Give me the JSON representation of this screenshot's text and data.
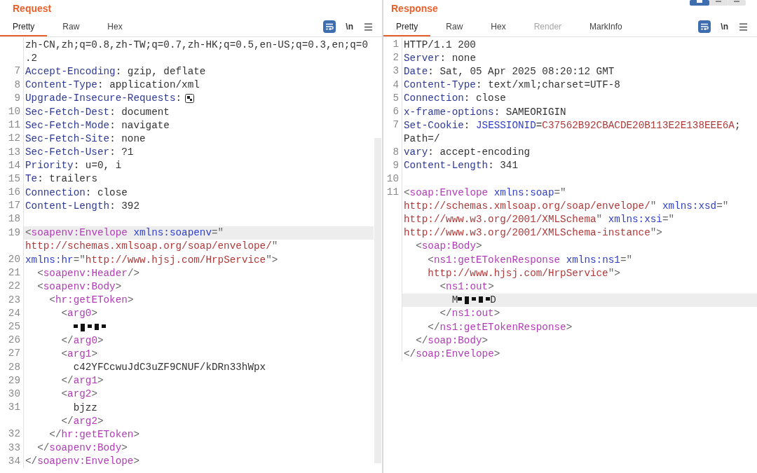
{
  "request": {
    "title": "Request",
    "tabs": [
      {
        "label": "Pretty",
        "selected": true,
        "disabled": false
      },
      {
        "label": "Raw",
        "selected": false,
        "disabled": false
      },
      {
        "label": "Hex",
        "selected": false,
        "disabled": false
      }
    ],
    "toolbar": {
      "newline_label": "\\n"
    },
    "lines": [
      {
        "highlighted": false,
        "tokens": [
          {
            "kind": "plain",
            "text": "zh-CN,zh;q=0.8,zh-TW;q=0.7,zh-HK;q=0.5,en-US;q=0.3,en;q=0"
          }
        ]
      },
      {
        "highlighted": false,
        "tokens": [
          {
            "kind": "plain",
            "text": ".2"
          }
        ]
      },
      {
        "number": "7",
        "highlighted": false,
        "tokens": [
          {
            "kind": "key",
            "text": "Accept-Encoding"
          },
          {
            "kind": "plain",
            "text": ": gzip, deflate"
          }
        ]
      },
      {
        "number": "8",
        "highlighted": false,
        "tokens": [
          {
            "kind": "key",
            "text": "Content-Type"
          },
          {
            "kind": "plain",
            "text": ": application/xml"
          }
        ]
      },
      {
        "number": "9",
        "highlighted": false,
        "tokens": [
          {
            "kind": "key",
            "text": "Upgrade-Insecure-Requests"
          },
          {
            "kind": "plain",
            "text": ":"
          },
          {
            "kind": "marker"
          }
        ]
      },
      {
        "number": "10",
        "highlighted": false,
        "tokens": [
          {
            "kind": "key",
            "text": "Sec-Fetch-Dest"
          },
          {
            "kind": "plain",
            "text": ": document"
          }
        ]
      },
      {
        "number": "11",
        "highlighted": false,
        "tokens": [
          {
            "kind": "key",
            "text": "Sec-Fetch-Mode"
          },
          {
            "kind": "plain",
            "text": ": navigate"
          }
        ]
      },
      {
        "number": "12",
        "highlighted": false,
        "tokens": [
          {
            "kind": "key",
            "text": "Sec-Fetch-Site"
          },
          {
            "kind": "plain",
            "text": ": none"
          }
        ]
      },
      {
        "number": "13",
        "highlighted": false,
        "tokens": [
          {
            "kind": "key",
            "text": "Sec-Fetch-User"
          },
          {
            "kind": "plain",
            "text": ": ?1"
          }
        ]
      },
      {
        "number": "14",
        "highlighted": false,
        "tokens": [
          {
            "kind": "key",
            "text": "Priority"
          },
          {
            "kind": "plain",
            "text": ": u=0, i"
          }
        ]
      },
      {
        "number": "15",
        "highlighted": false,
        "tokens": [
          {
            "kind": "key",
            "text": "Te"
          },
          {
            "kind": "plain",
            "text": ": trailers"
          }
        ]
      },
      {
        "number": "16",
        "highlighted": false,
        "tokens": [
          {
            "kind": "key",
            "text": "Connection"
          },
          {
            "kind": "plain",
            "text": ": close"
          }
        ]
      },
      {
        "number": "17",
        "highlighted": false,
        "tokens": [
          {
            "kind": "key",
            "text": "Content-Length"
          },
          {
            "kind": "plain",
            "text": ": 392"
          }
        ]
      },
      {
        "number": "18",
        "highlighted": false
      },
      {
        "number": "19",
        "highlighted": true,
        "tokens": [
          {
            "kind": "punct",
            "text": "<"
          },
          {
            "kind": "tag",
            "text": "soapenv:Envelope"
          },
          {
            "kind": "attr",
            "text": " xmlns:soapenv"
          },
          {
            "kind": "punct",
            "text": "=\""
          }
        ]
      },
      {
        "highlighted": false,
        "tokens": [
          {
            "kind": "value",
            "text": "http://schemas.xmlsoap.org/soap/envelope/"
          },
          {
            "kind": "punct",
            "text": "\""
          }
        ]
      },
      {
        "number": "20",
        "highlighted": false,
        "tokens": [
          {
            "kind": "attr",
            "text": "xmlns:hr"
          },
          {
            "kind": "punct",
            "text": "=\""
          },
          {
            "kind": "value",
            "text": "http://www.hjsj.com/HrpService"
          },
          {
            "kind": "punct",
            "text": "\">"
          }
        ]
      },
      {
        "number": "21",
        "highlighted": false,
        "tokens": [
          {
            "kind": "punct",
            "text": "  <"
          },
          {
            "kind": "tag",
            "text": "soapenv:Header"
          },
          {
            "kind": "punct",
            "text": "/>"
          }
        ]
      },
      {
        "number": "22",
        "highlighted": false,
        "tokens": [
          {
            "kind": "punct",
            "text": "  <"
          },
          {
            "kind": "tag",
            "text": "soapenv:Body"
          },
          {
            "kind": "punct",
            "text": ">"
          }
        ]
      },
      {
        "number": "23",
        "highlighted": false,
        "tokens": [
          {
            "kind": "punct",
            "text": "    <"
          },
          {
            "kind": "tag",
            "text": "hr:getEToken"
          },
          {
            "kind": "punct",
            "text": ">"
          }
        ]
      },
      {
        "number": "24",
        "highlighted": false,
        "tokens": [
          {
            "kind": "punct",
            "text": "      <"
          },
          {
            "kind": "tag",
            "text": "arg0"
          },
          {
            "kind": "punct",
            "text": ">"
          }
        ]
      },
      {
        "number": "25",
        "highlighted": false,
        "tokens": [
          {
            "kind": "redacted"
          }
        ]
      },
      {
        "number": "26",
        "highlighted": false,
        "tokens": [
          {
            "kind": "punct",
            "text": "      </"
          },
          {
            "kind": "tag",
            "text": "arg0"
          },
          {
            "kind": "punct",
            "text": ">"
          }
        ]
      },
      {
        "number": "27",
        "highlighted": false,
        "tokens": [
          {
            "kind": "punct",
            "text": "      <"
          },
          {
            "kind": "tag",
            "text": "arg1"
          },
          {
            "kind": "punct",
            "text": ">"
          }
        ]
      },
      {
        "number": "28",
        "highlighted": false,
        "tokens": [
          {
            "kind": "plain",
            "text": "        c42YFCcwuJdC3uZF9CNUF/kDRn33hWpx"
          }
        ]
      },
      {
        "number": "29",
        "highlighted": false,
        "tokens": [
          {
            "kind": "punct",
            "text": "      </"
          },
          {
            "kind": "tag",
            "text": "arg1"
          },
          {
            "kind": "punct",
            "text": ">"
          }
        ]
      },
      {
        "number": "30",
        "highlighted": false,
        "tokens": [
          {
            "kind": "punct",
            "text": "      <"
          },
          {
            "kind": "tag",
            "text": "arg2"
          },
          {
            "kind": "punct",
            "text": ">"
          }
        ]
      },
      {
        "number": "31",
        "highlighted": false,
        "tokens": [
          {
            "kind": "plain",
            "text": "        bjzz"
          }
        ]
      },
      {
        "highlighted": false,
        "tokens": [
          {
            "kind": "punct",
            "text": "      </"
          },
          {
            "kind": "tag",
            "text": "arg2"
          },
          {
            "kind": "punct",
            "text": ">"
          }
        ]
      },
      {
        "number": "32",
        "highlighted": false,
        "tokens": [
          {
            "kind": "punct",
            "text": "    </"
          },
          {
            "kind": "tag",
            "text": "hr:getEToken"
          },
          {
            "kind": "punct",
            "text": ">"
          }
        ]
      },
      {
        "number": "33",
        "highlighted": false,
        "tokens": [
          {
            "kind": "punct",
            "text": "  </"
          },
          {
            "kind": "tag",
            "text": "soapenv:Body"
          },
          {
            "kind": "punct",
            "text": ">"
          }
        ]
      },
      {
        "number": "34",
        "highlighted": false,
        "tokens": [
          {
            "kind": "punct",
            "text": "</"
          },
          {
            "kind": "tag",
            "text": "soapenv:Envelope"
          },
          {
            "kind": "punct",
            "text": ">"
          }
        ]
      }
    ]
  },
  "response": {
    "title": "Response",
    "tabs": [
      {
        "label": "Pretty",
        "selected": true,
        "disabled": false
      },
      {
        "label": "Raw",
        "selected": false,
        "disabled": false
      },
      {
        "label": "Hex",
        "selected": false,
        "disabled": false
      },
      {
        "label": "Render",
        "selected": false,
        "disabled": true
      },
      {
        "label": "MarkInfo",
        "selected": false,
        "disabled": false
      }
    ],
    "toolbar": {
      "newline_label": "\\n"
    },
    "lines": [
      {
        "number": "1",
        "highlighted": false,
        "tokens": [
          {
            "kind": "plain",
            "text": "HTTP/1.1 200"
          }
        ]
      },
      {
        "number": "2",
        "highlighted": false,
        "tokens": [
          {
            "kind": "key",
            "text": "Server"
          },
          {
            "kind": "plain",
            "text": ": none"
          }
        ]
      },
      {
        "number": "3",
        "highlighted": false,
        "tokens": [
          {
            "kind": "key",
            "text": "Date"
          },
          {
            "kind": "plain",
            "text": ": Sat, 05 Apr 2025 08:20:12 GMT"
          }
        ]
      },
      {
        "number": "4",
        "highlighted": false,
        "tokens": [
          {
            "kind": "key",
            "text": "Content-Type"
          },
          {
            "kind": "plain",
            "text": ": text/xml;charset=UTF-8"
          }
        ]
      },
      {
        "number": "5",
        "highlighted": false,
        "tokens": [
          {
            "kind": "key",
            "text": "Connection"
          },
          {
            "kind": "plain",
            "text": ": close"
          }
        ]
      },
      {
        "number": "6",
        "highlighted": false,
        "tokens": [
          {
            "kind": "key",
            "text": "x-frame-options"
          },
          {
            "kind": "plain",
            "text": ": SAMEORIGIN"
          }
        ]
      },
      {
        "number": "7",
        "highlighted": false,
        "tokens": [
          {
            "kind": "key",
            "text": "Set-Cookie"
          },
          {
            "kind": "plain",
            "text": ": "
          },
          {
            "kind": "attr",
            "text": "JSESSIONID"
          },
          {
            "kind": "plain",
            "text": "="
          },
          {
            "kind": "value",
            "text": "C37562B92CBACDE20B113E2E138EEE6A"
          },
          {
            "kind": "plain",
            "text": ";"
          }
        ]
      },
      {
        "highlighted": false,
        "tokens": [
          {
            "kind": "plain",
            "text": "Path=/"
          }
        ]
      },
      {
        "number": "8",
        "highlighted": false,
        "tokens": [
          {
            "kind": "key",
            "text": "vary"
          },
          {
            "kind": "plain",
            "text": ": accept-encoding"
          }
        ]
      },
      {
        "number": "9",
        "highlighted": false,
        "tokens": [
          {
            "kind": "key",
            "text": "Content-Length"
          },
          {
            "kind": "plain",
            "text": ": 341"
          }
        ]
      },
      {
        "number": "10",
        "highlighted": false
      },
      {
        "number": "11",
        "highlighted": false,
        "tokens": [
          {
            "kind": "punct",
            "text": "<"
          },
          {
            "kind": "tag",
            "text": "soap:Envelope"
          },
          {
            "kind": "attr",
            "text": " xmlns:soap"
          },
          {
            "kind": "punct",
            "text": "=\""
          }
        ]
      },
      {
        "highlighted": false,
        "tokens": [
          {
            "kind": "value",
            "text": "http://schemas.xmlsoap.org/soap/envelope/"
          },
          {
            "kind": "punct",
            "text": "\" "
          },
          {
            "kind": "attr",
            "text": "xmlns:xsd"
          },
          {
            "kind": "punct",
            "text": "=\""
          }
        ]
      },
      {
        "highlighted": false,
        "tokens": [
          {
            "kind": "value",
            "text": "http://www.w3.org/2001/XMLSchema"
          },
          {
            "kind": "punct",
            "text": "\" "
          },
          {
            "kind": "attr",
            "text": "xmlns:xsi"
          },
          {
            "kind": "punct",
            "text": "=\""
          }
        ]
      },
      {
        "highlighted": false,
        "tokens": [
          {
            "kind": "value",
            "text": "http://www.w3.org/2001/XMLSchema-instance"
          },
          {
            "kind": "punct",
            "text": "\">"
          }
        ]
      },
      {
        "highlighted": false,
        "tokens": [
          {
            "kind": "punct",
            "text": "  <"
          },
          {
            "kind": "tag",
            "text": "soap:Body"
          },
          {
            "kind": "punct",
            "text": ">"
          }
        ]
      },
      {
        "highlighted": false,
        "tokens": [
          {
            "kind": "punct",
            "text": "    <"
          },
          {
            "kind": "tag",
            "text": "ns1:getETokenResponse"
          },
          {
            "kind": "attr",
            "text": " xmlns:ns1"
          },
          {
            "kind": "punct",
            "text": "=\""
          }
        ]
      },
      {
        "highlighted": false,
        "tokens": [
          {
            "kind": "value",
            "text": "    http://www.hjsj.com/HrpService"
          },
          {
            "kind": "punct",
            "text": "\">"
          }
        ]
      },
      {
        "highlighted": false,
        "tokens": [
          {
            "kind": "punct",
            "text": "      <"
          },
          {
            "kind": "tag",
            "text": "ns1:out"
          },
          {
            "kind": "punct",
            "text": ">"
          }
        ]
      },
      {
        "highlighted": true,
        "tokens": [
          {
            "kind": "plain",
            "text": "        M"
          },
          {
            "kind": "redacted"
          },
          {
            "kind": "plain",
            "text": "D"
          }
        ]
      },
      {
        "highlighted": false,
        "tokens": [
          {
            "kind": "punct",
            "text": "      </"
          },
          {
            "kind": "tag",
            "text": "ns1:out"
          },
          {
            "kind": "punct",
            "text": ">"
          }
        ]
      },
      {
        "highlighted": false,
        "tokens": [
          {
            "kind": "punct",
            "text": "    </"
          },
          {
            "kind": "tag",
            "text": "ns1:getETokenResponse"
          },
          {
            "kind": "punct",
            "text": ">"
          }
        ]
      },
      {
        "highlighted": false,
        "tokens": [
          {
            "kind": "punct",
            "text": "  </"
          },
          {
            "kind": "tag",
            "text": "soap:Body"
          },
          {
            "kind": "punct",
            "text": ">"
          }
        ]
      },
      {
        "highlighted": false,
        "tokens": [
          {
            "kind": "punct",
            "text": "</"
          },
          {
            "kind": "tag",
            "text": "soap:Envelope"
          },
          {
            "kind": "punct",
            "text": ">"
          }
        ]
      }
    ]
  }
}
